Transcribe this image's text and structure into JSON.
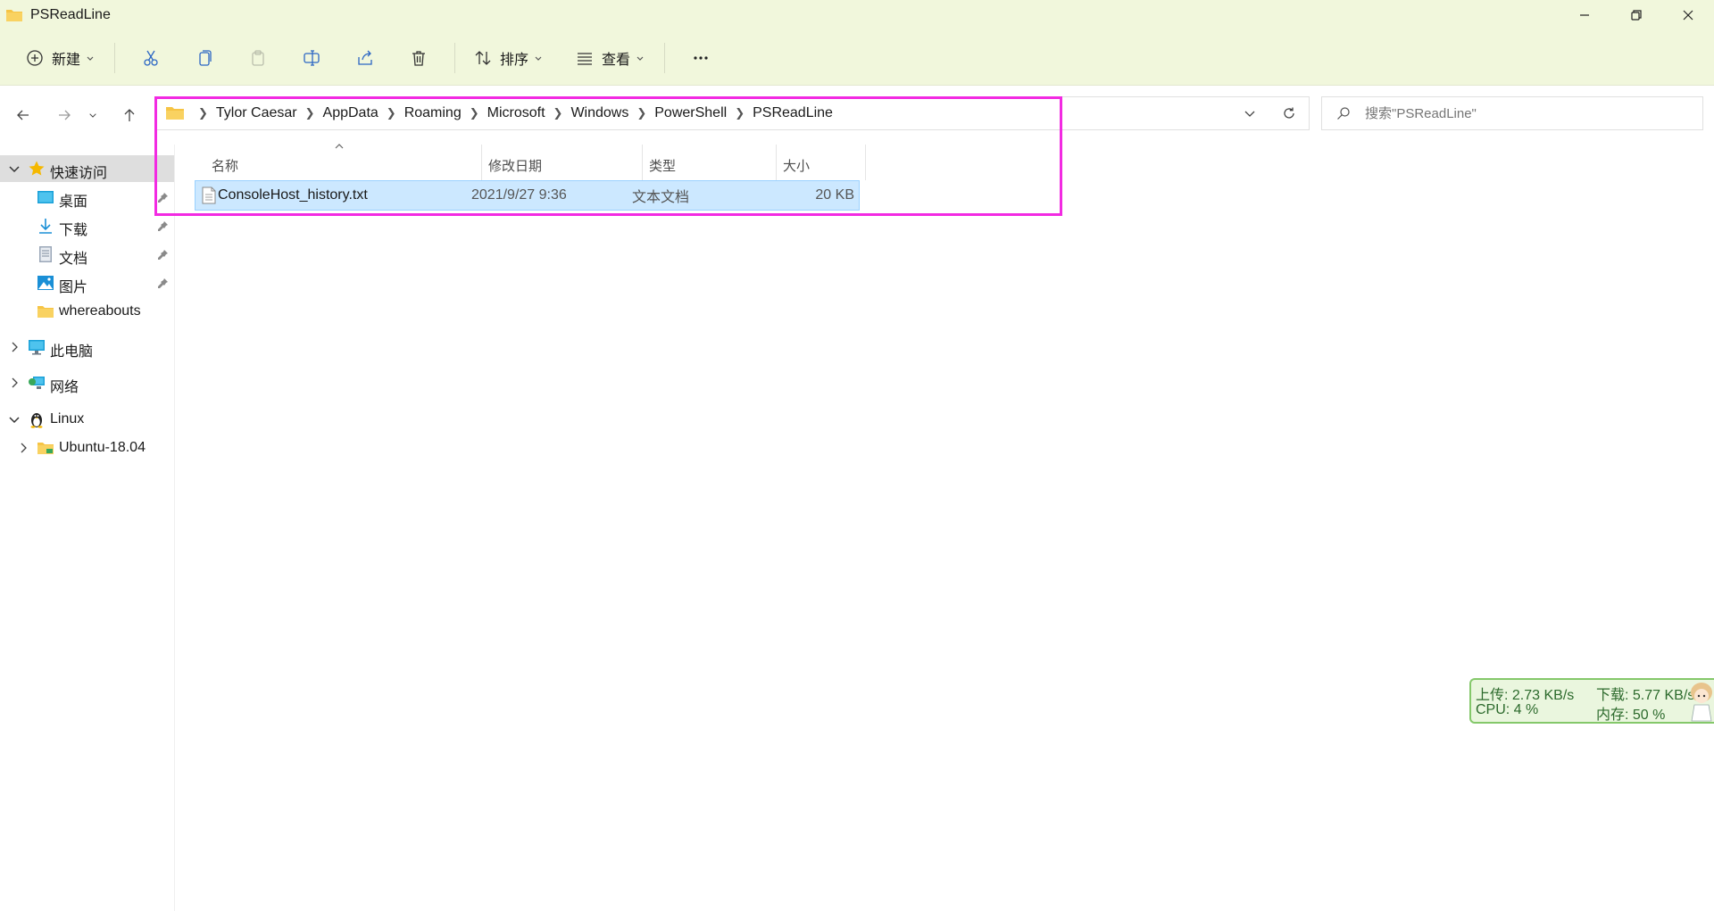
{
  "window": {
    "title": "PSReadLine"
  },
  "toolbar": {
    "new_label": "新建",
    "sort_label": "排序",
    "view_label": "查看"
  },
  "address": {
    "crumbs": [
      "Tylor Caesar",
      "AppData",
      "Roaming",
      "Microsoft",
      "Windows",
      "PowerShell",
      "PSReadLine"
    ]
  },
  "search": {
    "placeholder": "搜索\"PSReadLine\""
  },
  "sidebar": {
    "quick_access": "快速访问",
    "desktop": "桌面",
    "downloads": "下载",
    "documents": "文档",
    "pictures": "图片",
    "whereabouts": "whereabouts",
    "this_pc": "此电脑",
    "network": "网络",
    "linux": "Linux",
    "ubuntu": "Ubuntu-18.04"
  },
  "columns": {
    "name": "名称",
    "date": "修改日期",
    "type": "类型",
    "size": "大小"
  },
  "files": [
    {
      "name": "ConsoleHost_history.txt",
      "date": "2021/9/27 9:36",
      "type": "文本文档",
      "size": "20 KB"
    }
  ],
  "netmon": {
    "upload": "上传: 2.73 KB/s",
    "download": "下载: 5.77 KB/s",
    "cpu": "CPU: 4 %",
    "memory": "内存: 50 %"
  },
  "colors": {
    "titlebar_bg": "#f1f7dc",
    "selection_bg": "#cce8ff",
    "highlight_box": "#f22ae2",
    "folder": "#f6c445"
  }
}
